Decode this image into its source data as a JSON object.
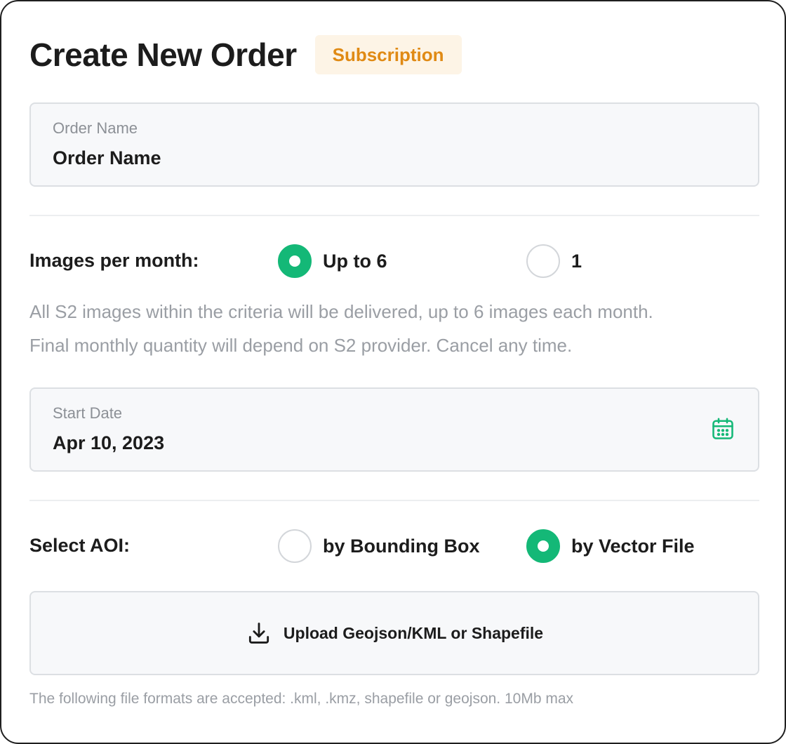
{
  "header": {
    "title": "Create New Order",
    "badge": "Subscription"
  },
  "order_name": {
    "label": "Order Name",
    "value": "Order Name"
  },
  "images_per_month": {
    "label": "Images per month:",
    "options": [
      {
        "label": "Up to 6",
        "selected": true
      },
      {
        "label": "1",
        "selected": false
      }
    ],
    "hint_line1": "All S2 images within the criteria will be delivered, up to 6 images each month.",
    "hint_line2": "Final monthly quantity will depend on S2 provider. Cancel any time."
  },
  "start_date": {
    "label": "Start Date",
    "value": "Apr 10, 2023",
    "icon": "calendar-icon"
  },
  "aoi": {
    "label": "Select AOI:",
    "options": [
      {
        "label": "by Bounding Box",
        "selected": false
      },
      {
        "label": "by Vector File",
        "selected": true
      }
    ]
  },
  "upload": {
    "label": "Upload Geojson/KML or Shapefile",
    "icon": "download-icon",
    "formats_note": "The following file formats are accepted: .kml, .kmz, shapefile or geojson. 10Mb max"
  },
  "colors": {
    "accent": "#14b877",
    "badge_text": "#e08a14",
    "badge_bg": "#fdf4e6"
  }
}
